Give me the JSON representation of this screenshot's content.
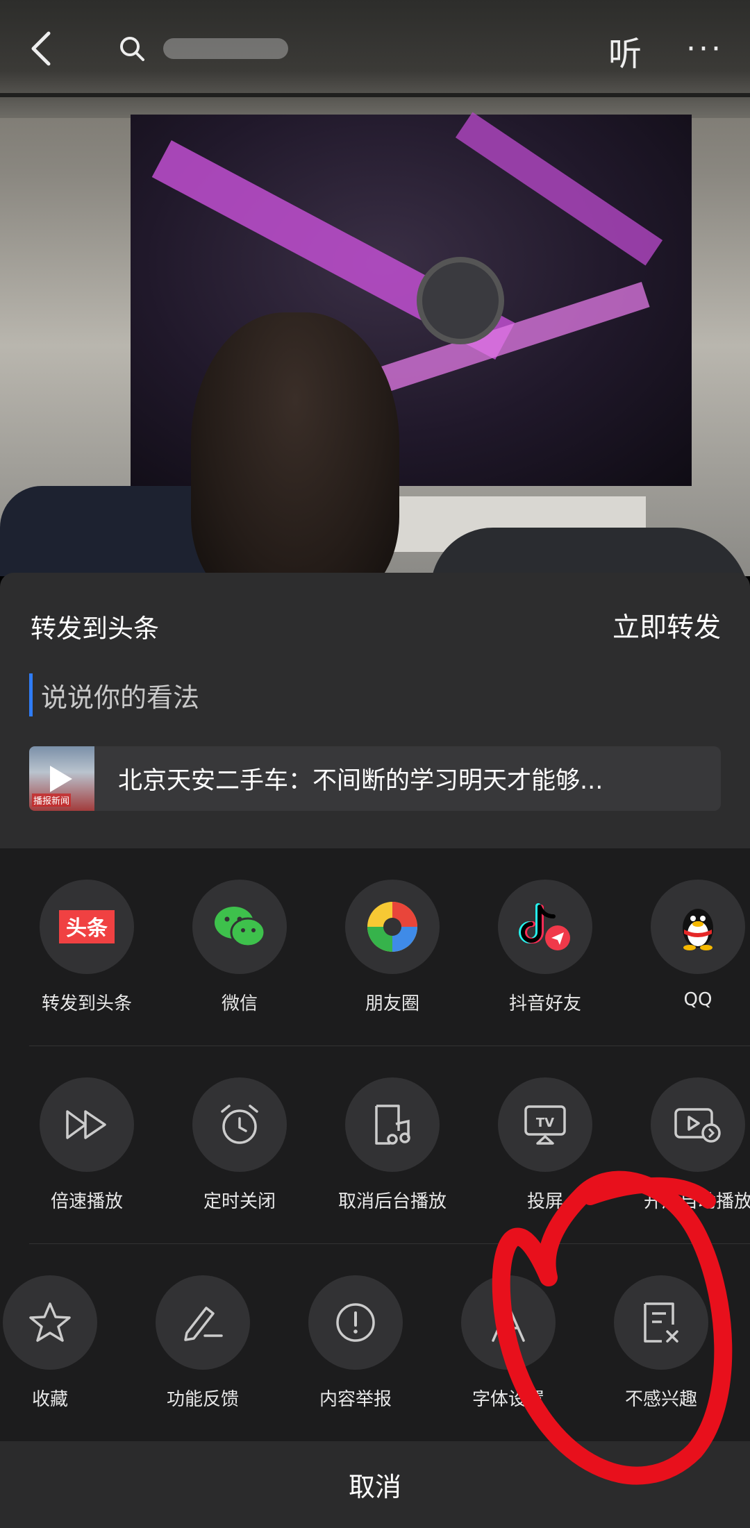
{
  "topbar": {
    "listen_label": "听",
    "more_label": "···"
  },
  "repost": {
    "title": "转发到头条",
    "action": "立即转发",
    "placeholder": "说说你的看法",
    "article_title": "北京天安二手车：不间断的学习明天才能够...",
    "thumb_caption": "播报新闻"
  },
  "share_row": [
    {
      "label": "转发到头条",
      "icon": "toutiao-icon"
    },
    {
      "label": "微信",
      "icon": "wechat-icon"
    },
    {
      "label": "朋友圈",
      "icon": "moments-icon"
    },
    {
      "label": "抖音好友",
      "icon": "douyin-icon"
    },
    {
      "label": "QQ",
      "icon": "qq-icon"
    }
  ],
  "tools_row": [
    {
      "label": "倍速播放",
      "icon": "fast-forward-icon"
    },
    {
      "label": "定时关闭",
      "icon": "alarm-clock-icon"
    },
    {
      "label": "取消后台播放",
      "icon": "music-file-icon"
    },
    {
      "label": "投屏",
      "icon": "tv-cast-icon"
    },
    {
      "label": "开启自动播放",
      "icon": "autoplay-icon"
    }
  ],
  "actions_row": [
    {
      "label": "收藏",
      "icon": "star-icon"
    },
    {
      "label": "功能反馈",
      "icon": "edit-pencil-icon"
    },
    {
      "label": "内容举报",
      "icon": "report-exclamation-icon"
    },
    {
      "label": "字体设置",
      "icon": "font-icon"
    },
    {
      "label": "不感兴趣",
      "icon": "not-interested-icon"
    }
  ],
  "cancel_label": "取消",
  "colors": {
    "sheet_bg": "#1c1c1d",
    "panel_bg": "#2d2d2e",
    "accent_blue": "#2f7cf6",
    "annotation_red": "#e8101c"
  }
}
